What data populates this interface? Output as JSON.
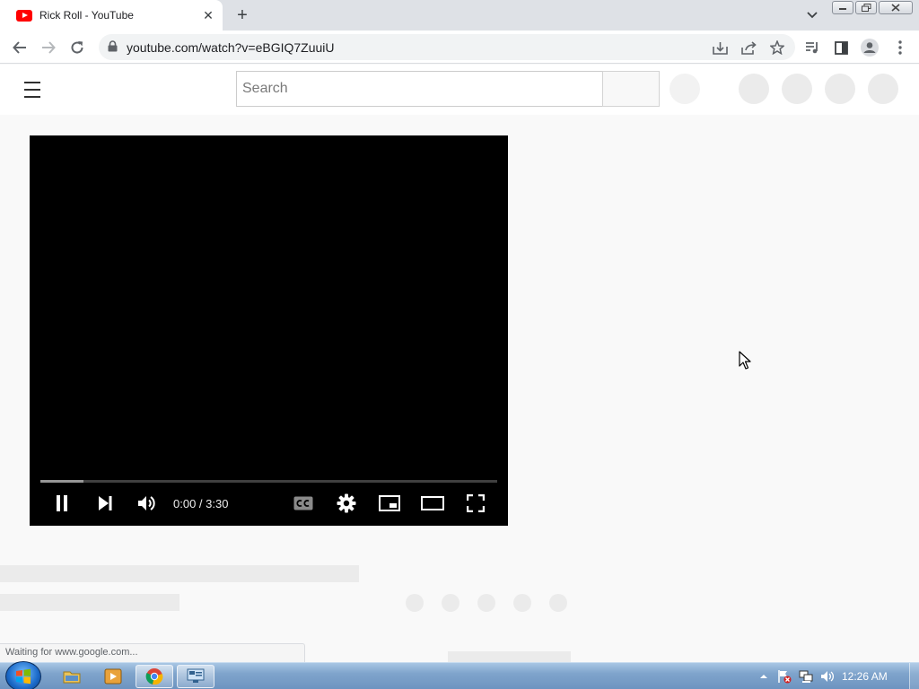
{
  "browser": {
    "tab": {
      "title": "Rick Roll - YouTube",
      "close_glyph": "✕",
      "favicon": "youtube-favicon"
    },
    "new_tab_glyph": "+",
    "url": "youtube.com/watch?v=eBGIQ7ZuuiU",
    "status_text": "Waiting for www.google.com..."
  },
  "youtube": {
    "search_placeholder": "Search"
  },
  "player": {
    "time": "0:00 / 3:30",
    "progress_loaded_fraction": 0.095
  },
  "taskbar": {
    "clock": "12:26 AM",
    "apps": [
      "windows-explorer",
      "media-player",
      "chrome",
      "remote-desktop"
    ]
  },
  "colors": {
    "youtube_red": "#ff0000",
    "chrome_frame": "#dee1e6",
    "player_bg": "#000000",
    "placeholder": "#ebebeb"
  }
}
